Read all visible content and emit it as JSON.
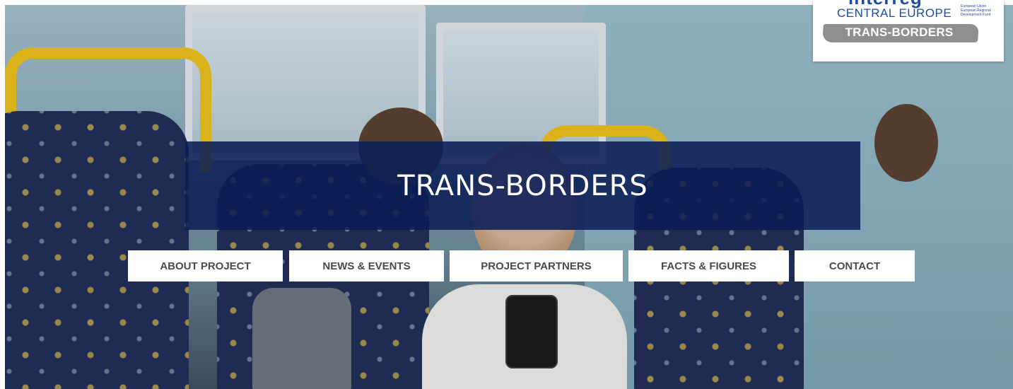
{
  "hero": {
    "title": "TRANS-BORDERS"
  },
  "nav": {
    "items": [
      {
        "label": "ABOUT PROJECT"
      },
      {
        "label": "NEWS & EVENTS"
      },
      {
        "label": "PROJECT PARTNERS"
      },
      {
        "label": "FACTS & FIGURES"
      },
      {
        "label": "CONTACT"
      }
    ]
  },
  "logo": {
    "program": "interreg",
    "region": "CENTRAL EUROPE",
    "eu_lines": [
      "European Union",
      "European Regional",
      "Development Fund"
    ],
    "project": "TRANS-BORDERS"
  },
  "colors": {
    "banner": "#0a1e55",
    "logo_blue": "#1d4e9e",
    "nav_text": "#4a4a4a",
    "handle_yellow": "#f2c316"
  }
}
